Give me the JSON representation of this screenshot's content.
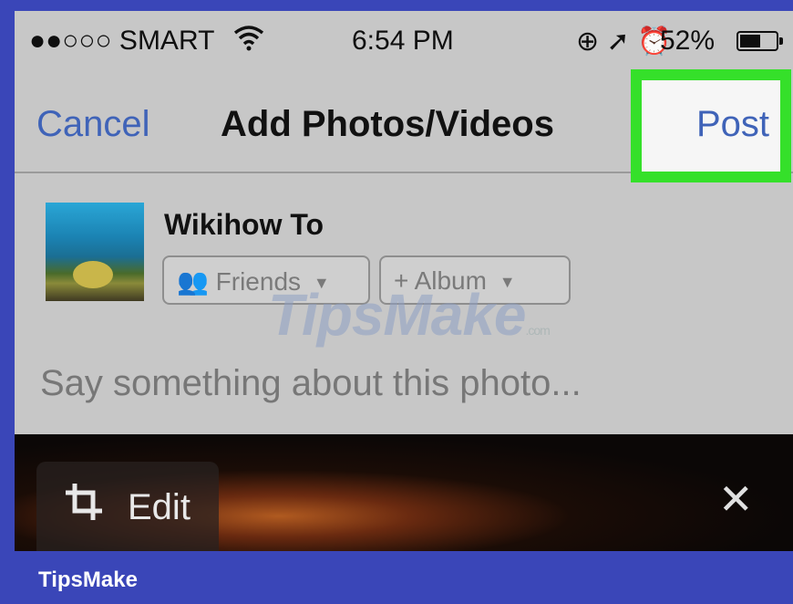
{
  "status_bar": {
    "carrier": "●●○○○ SMART",
    "wifi_icon": "wifi-icon",
    "time": "6:54 PM",
    "status_icons": "⊕ ➚ ⏰",
    "battery_pct": "52%"
  },
  "nav": {
    "cancel": "Cancel",
    "title": "Add Photos/Videos",
    "post": "Post"
  },
  "composer": {
    "user_name": "Wikihow To",
    "audience_label": "Friends",
    "album_label": "+ Album",
    "placeholder": "Say something about this photo..."
  },
  "photo": {
    "edit_label": "Edit",
    "close_glyph": "✕"
  },
  "watermark": {
    "text": "TipsMake",
    "suffix": ".com"
  },
  "footer": {
    "brand": "TipsMake"
  },
  "colors": {
    "frame": "#3a46b8",
    "highlight": "#35e02a",
    "link": "#3f63b8"
  }
}
